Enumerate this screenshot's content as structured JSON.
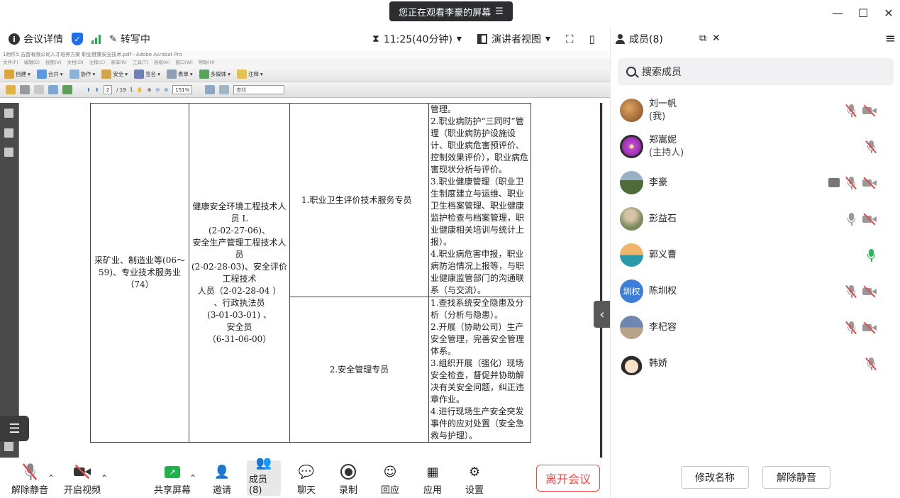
{
  "window": {
    "share_banner": "您正在观看李豪的屏幕",
    "banner_menu_icon": "list-icon"
  },
  "topbar": {
    "meeting_details": "会议详情",
    "transcribe": "转写中",
    "timer": "11:25(40分钟)",
    "view_mode": "演讲者视图"
  },
  "pdf": {
    "file_title": "1附件5 吉首有限公司人才培养方案 职业健康安全技术.pdf - Adobe Acrobat Pro",
    "menu": [
      "文件(F)",
      "编辑(E)",
      "视图(V)",
      "文档(D)",
      "注释(C)",
      "表单(R)",
      "工具(T)",
      "高级(A)",
      "窗口(W)",
      "帮助(H)"
    ],
    "toolbar": [
      "创建",
      "合并",
      "协作",
      "安全",
      "签名",
      "表单",
      "多媒体",
      "注释"
    ],
    "page_current": "2",
    "page_total": "/ 19",
    "zoom": "151%",
    "find_placeholder": "查找"
  },
  "table": {
    "industry": "采矿业、制造业等(06～59)、专业技术服务业（74）",
    "occupations": "健康安全环境工程技术人员 L\n(2-02-27-06)、\n安全生产管理工程技术人员\n(2-02-28-03)、安全评价工程技术\n人员（2-02-28-04 ）\n、行政执法员\n(3-01-03-01) 、\n安全员\n（6-31-06-00）",
    "position1": "1.职业卫生评价技术服务专员",
    "tasks1": "管理。\n2.职业病防护“三同时”管理（职业病防护设施设计、职业病危害预评价、控制效果评价），职业病危害现状分析与评价。\n3.职业健康管理（职业卫生制度建立与运维、职业卫生档案管理、职业健康监护检查与档案管理，职业健康相关培训与统计上报）。\n4.职业病危害申报，职业病防治情况上报等，与职业健康监管部门的沟通联系（与交流）。",
    "position2": "2.安全管理专员",
    "tasks2": "1.查找系统安全隐患及分析（分析与隐患）。\n2.开展（协助公司）生产安全管理，完善安全管理体系。\n3.组织开展（强化）现场安全检查，督促并协助解决有关安全问题，纠正违章作业。\n4.进行现场生产安全突发事件的应对处置（安全急救与护理）。"
  },
  "bottom": {
    "unmute": "解除静音",
    "start_video": "开启视频",
    "share_screen": "共享屏幕",
    "invite": "邀请",
    "members": "成员(8)",
    "chat": "聊天",
    "record": "录制",
    "react": "回应",
    "apps": "应用",
    "settings": "设置",
    "leave": "离开会议"
  },
  "panel": {
    "title": "成员(8)",
    "search_placeholder": "搜索成员",
    "rename": "修改名称",
    "unmute_all": "解除静音",
    "members": [
      {
        "name": "刘一帆",
        "role": "(我)",
        "mic": "muted",
        "cam": "off",
        "avatar_color": "#a86b3c"
      },
      {
        "name": "郑嵩妮",
        "role": "(主持人)",
        "mic": "muted",
        "cam": "none",
        "avatar_color": "#c44bd6"
      },
      {
        "name": "李豪",
        "role": "",
        "mic": "muted",
        "cam": "off",
        "sharing": true,
        "avatar_color": "#4f6b3a"
      },
      {
        "name": "彭益石",
        "role": "",
        "mic": "idle",
        "cam": "off",
        "avatar_color": "#7a8a5c"
      },
      {
        "name": "郭义曹",
        "role": "",
        "mic": "on",
        "cam": "none",
        "avatar_color": "#e89a5a"
      },
      {
        "name": "陈圳权",
        "role": "",
        "mic": "muted",
        "cam": "off",
        "avatar_color": "#3f7ed8",
        "initials": "圳权"
      },
      {
        "name": "李杞容",
        "role": "",
        "mic": "muted",
        "cam": "off",
        "avatar_color": "#6f86b0"
      },
      {
        "name": "韩娇",
        "role": "",
        "mic": "muted",
        "cam": "none",
        "avatar_color": "#f2c7a4"
      }
    ]
  },
  "colors": {
    "accent_blue": "#1e6fe8",
    "leave_red": "#f04a4a",
    "mic_green": "#2fb65a",
    "muted_red": "#e24b4b"
  }
}
